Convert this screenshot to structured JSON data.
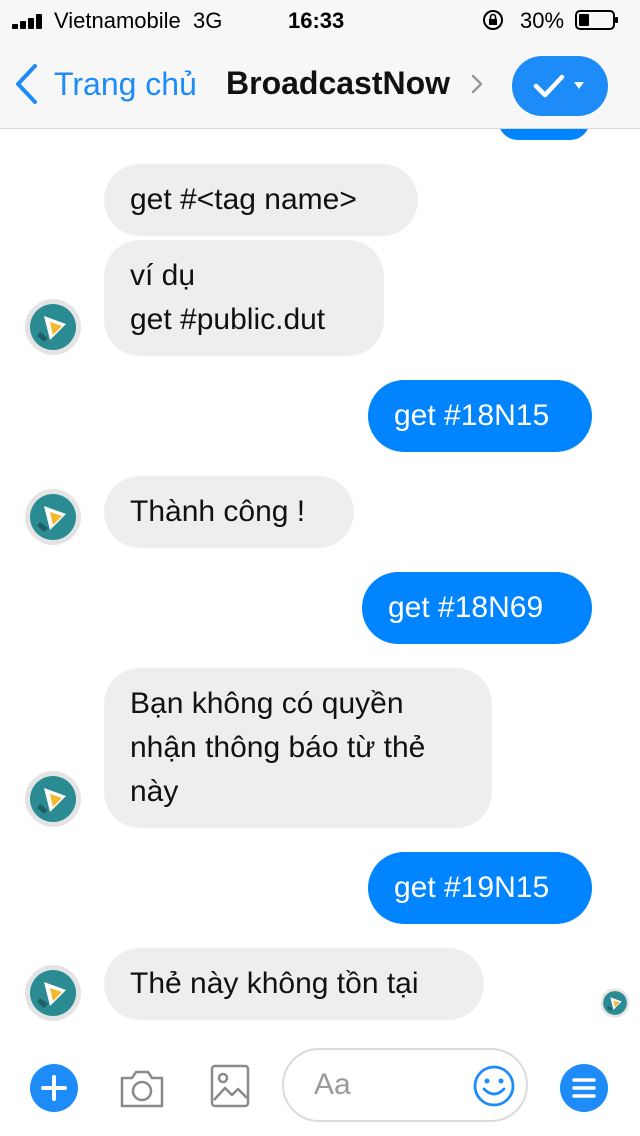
{
  "status_bar": {
    "carrier": "Vietnamobile  3G",
    "time": "16:33",
    "battery": "30%"
  },
  "nav": {
    "back_label": "Trang chủ",
    "title": "BroadcastNow",
    "icons": [
      "chevron-left-icon",
      "chevron-right-icon",
      "checkmark-icon",
      "caret-down-icon"
    ]
  },
  "messages": [
    {
      "side": "in",
      "text": "get #<tag name>"
    },
    {
      "side": "in",
      "text": "ví dụ\nget #public.dut"
    },
    {
      "side": "out",
      "text": "get #18N15"
    },
    {
      "side": "in",
      "text": "Thành công !"
    },
    {
      "side": "out",
      "text": "get #18N69"
    },
    {
      "side": "in",
      "text": "Bạn không có quyền\nnhận thông báo từ thẻ\nnày"
    },
    {
      "side": "out",
      "text": "get #19N15"
    },
    {
      "side": "in",
      "text": "Thẻ này không tồn tại"
    }
  ],
  "composer": {
    "placeholder": "Aa",
    "icons": [
      "plus-icon",
      "camera-icon",
      "image-icon",
      "emoji-icon",
      "menu-icon"
    ]
  },
  "colors": {
    "accent": "#1d8cf8",
    "outgoing_bubble": "#0084ff",
    "incoming_bubble": "#eeeeee",
    "avatar_bg": "#2a8b93",
    "avatar_ring": "#e4e4e4"
  }
}
